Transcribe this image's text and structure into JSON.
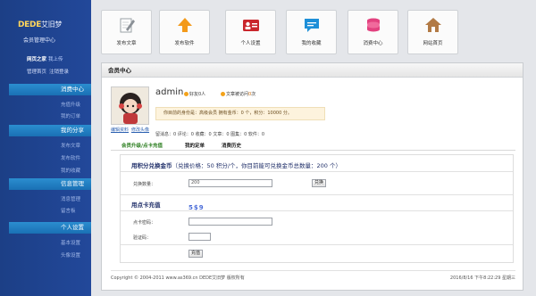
{
  "sidebar": {
    "logo_brand": "DEDE",
    "logo_cn": "艾旧梦",
    "subtitle": "会员管理中心",
    "user": "网页之家",
    "logout": "我上传",
    "home_links": [
      "管理首页",
      "注销登录"
    ],
    "groups": [
      {
        "title": "消费中心",
        "items": [
          "充值升级",
          "我的订单"
        ]
      },
      {
        "title": "我的分享",
        "items": [
          "发布文章",
          "发布软件",
          "我的收藏"
        ]
      },
      {
        "title": "信息管理",
        "items": [
          "消息管理",
          "留言板"
        ]
      },
      {
        "title": "个人设置",
        "items": [
          "基本设置",
          "头像设置"
        ]
      }
    ]
  },
  "toolbar": [
    {
      "label": "发布文章",
      "icon": "pencil-doc-icon",
      "color": "#9aa0a6"
    },
    {
      "label": "发布软件",
      "icon": "upload-arrow-icon",
      "color": "#f39a1a"
    },
    {
      "label": "个人设置",
      "icon": "id-card-icon",
      "color": "#c9262c"
    },
    {
      "label": "我的收藏",
      "icon": "chat-bubble-icon",
      "color": "#1d8fd8"
    },
    {
      "label": "消费中心",
      "icon": "coins-stack-icon",
      "color": "#e2417f"
    },
    {
      "label": "网站首页",
      "icon": "home-icon",
      "color": "#b27a45"
    }
  ],
  "panel": {
    "title": "会员中心",
    "username": "admin",
    "friends": "好友0人",
    "visits_prefix": "文章被访问",
    "visits_count": "0",
    "visits_suffix": "次",
    "info_bar": "你目前的身份是：高级会员 拥有金币：0 个，积分：10000 分。",
    "avatar_links": [
      "编辑资料",
      "修改头像"
    ],
    "stats": "留消息：0  评论：0  收藏：0  文章：0  图集：0  软件：0",
    "tabs": [
      "会员升级/点卡充值",
      "我的定单",
      "消费历史"
    ],
    "exchange": {
      "title": "用积分兑换金币",
      "note": "（兑换价格：50 积分/个，你目前能可兑换金币总数量：200 个）",
      "label": "兑换数量：",
      "value": "200",
      "button": "兑换"
    },
    "recharge": {
      "title": "用点卡充值",
      "card_label": "点卡密码：",
      "code_label": "验证码：",
      "captcha": "5$9",
      "button": "充值"
    },
    "footer_left": "Copyright © 2004-2011 www.as369.cn DEDE艾旧梦 版权所有",
    "footer_right": "2016/8/16 下午8:22:29 星期三"
  }
}
